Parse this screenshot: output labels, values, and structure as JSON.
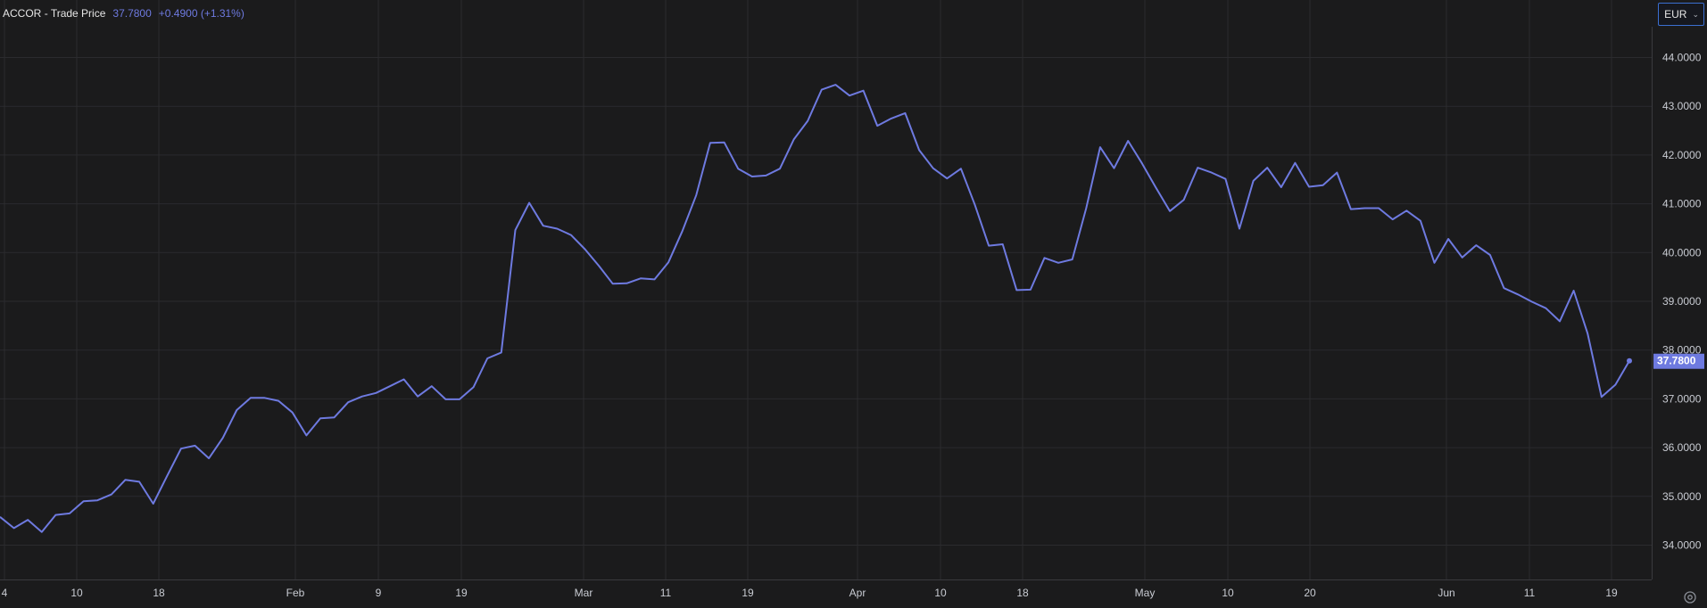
{
  "legend": {
    "symbol": "ACCOR",
    "separator": "-",
    "label": "Trade Price",
    "price": "37.7800",
    "change": "+0.4900 (+1.31%)"
  },
  "currency": {
    "selected": "EUR",
    "icon": "chevron-down-icon"
  },
  "settings": {
    "icon": "settings-icon"
  },
  "colors": {
    "background": "#1b1b1c",
    "line": "#6e7ae0",
    "grid": "#2b2b2e",
    "text": "#d1d4dc",
    "last_price_badge": "#6e7ae0"
  },
  "chart_data": {
    "type": "line",
    "title": "ACCOR - Trade Price",
    "currency": "EUR",
    "last_price": 37.78,
    "last_price_label": "37.7800",
    "ylim": [
      33.6,
      44.7
    ],
    "y_ticks": [
      34,
      35,
      36,
      37,
      38,
      39,
      40,
      41,
      42,
      43,
      44
    ],
    "y_tick_labels": [
      "34.0000",
      "35.0000",
      "36.0000",
      "37.0000",
      "38.0000",
      "39.0000",
      "40.0000",
      "41.0000",
      "42.0000",
      "43.0000",
      "44.0000"
    ],
    "x_ticks": [
      "4",
      "10",
      "18",
      "Feb",
      "9",
      "19",
      "Mar",
      "11",
      "19",
      "Apr",
      "10",
      "18",
      "May",
      "10",
      "20",
      "Jun",
      "11",
      "19"
    ],
    "grid": true,
    "series": [
      {
        "values": [
          34.58,
          34.35,
          34.52,
          34.27,
          34.62,
          34.65,
          34.9,
          34.92,
          35.04,
          35.34,
          35.3,
          34.85,
          35.42,
          35.98,
          36.04,
          35.78,
          36.2,
          36.77,
          37.02,
          37.02,
          36.96,
          36.72,
          36.25,
          36.6,
          36.62,
          36.93,
          37.05,
          37.12,
          37.26,
          37.4,
          37.05,
          37.26,
          36.99,
          36.99,
          37.24,
          37.83,
          37.95,
          40.46,
          41.02,
          40.55,
          40.49,
          40.36,
          40.07,
          39.73,
          39.36,
          39.37,
          39.47,
          39.45,
          39.8,
          40.44,
          41.18,
          42.25,
          42.26,
          41.72,
          41.56,
          41.58,
          41.72,
          42.32,
          42.7,
          43.34,
          43.44,
          43.22,
          43.32,
          42.6,
          42.75,
          42.86,
          42.1,
          41.73,
          41.52,
          41.72,
          40.98,
          40.14,
          40.17,
          39.23,
          39.24,
          39.89,
          39.79,
          39.86,
          40.91,
          42.16,
          41.73,
          42.29,
          41.83,
          41.33,
          40.85,
          41.08,
          41.74,
          41.64,
          41.51,
          40.49,
          41.47,
          41.74,
          41.34,
          41.84,
          41.35,
          41.38,
          41.64,
          40.89,
          40.91,
          40.91,
          40.68,
          40.86,
          40.65,
          39.79,
          40.28,
          39.9,
          40.15,
          39.95,
          39.27,
          39.14,
          38.99,
          38.86,
          38.59,
          39.22,
          38.34,
          37.04,
          37.29,
          37.78
        ]
      }
    ]
  }
}
